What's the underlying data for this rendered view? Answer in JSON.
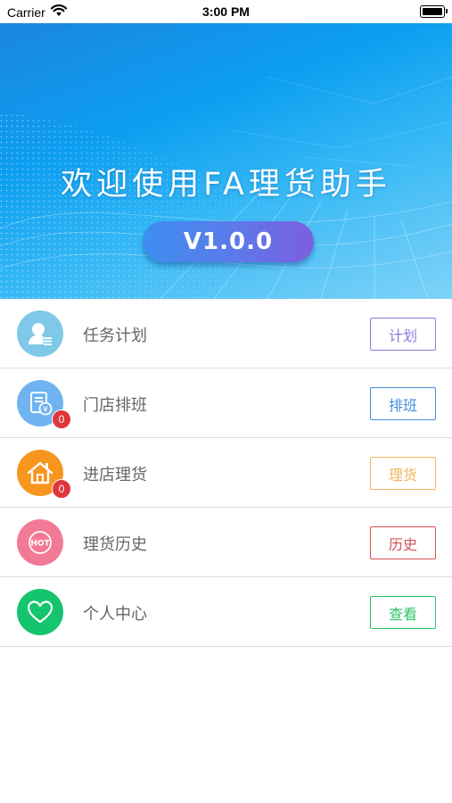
{
  "status_bar": {
    "carrier": "Carrier",
    "time": "3:00 PM"
  },
  "banner": {
    "title": "欢迎使用FA理货助手",
    "version": "V1.0.0"
  },
  "menu": [
    {
      "label": "任务计划",
      "button": "计划",
      "icon": "user-list-icon",
      "icon_color": "#7fc8e8",
      "button_color": "#8a7be0",
      "badge": null
    },
    {
      "label": "门店排班",
      "button": "排班",
      "icon": "document-yen-icon",
      "icon_color": "#6fb4f0",
      "button_color": "#3f8ee0",
      "badge": "0"
    },
    {
      "label": "进店理货",
      "button": "理货",
      "icon": "home-icon",
      "icon_color": "#f7961f",
      "button_color": "#f2b35a",
      "badge": "0"
    },
    {
      "label": "理货历史",
      "button": "历史",
      "icon": "hot-icon",
      "icon_color": "#f27a96",
      "button_color": "#d85050",
      "badge": null
    },
    {
      "label": "个人中心",
      "button": "查看",
      "icon": "heart-icon",
      "icon_color": "#15c46e",
      "button_color": "#2ec265",
      "badge": null
    }
  ]
}
